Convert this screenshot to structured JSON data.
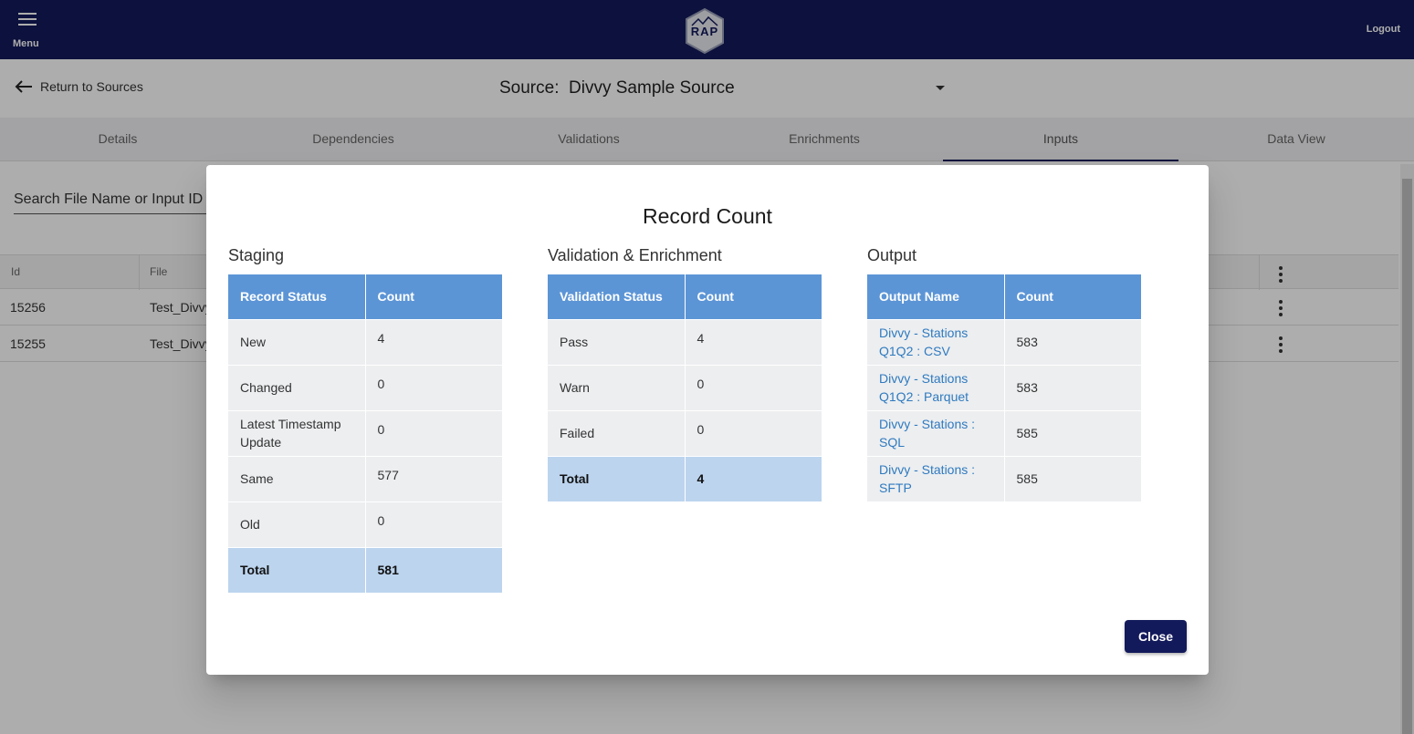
{
  "header": {
    "menu_label": "Menu",
    "logo_text": "RAP",
    "logout_label": "Logout"
  },
  "subheader": {
    "back_label": "Return to Sources",
    "source_title": "Source:  Divvy Sample Source"
  },
  "tabs": [
    {
      "label": "Details"
    },
    {
      "label": "Dependencies"
    },
    {
      "label": "Validations"
    },
    {
      "label": "Enrichments"
    },
    {
      "label": "Inputs",
      "active": true
    },
    {
      "label": "Data View"
    }
  ],
  "search": {
    "placeholder": "Search File Name or Input ID"
  },
  "grid": {
    "columns": [
      "Id",
      "File"
    ],
    "rows": [
      {
        "id": "15256",
        "file": "Test_Divvy"
      },
      {
        "id": "15255",
        "file": "Test_Divvy"
      }
    ]
  },
  "modal": {
    "title": "Record Count",
    "close_label": "Close",
    "staging": {
      "title": "Staging",
      "headers": [
        "Record Status",
        "Count"
      ],
      "rows": [
        {
          "label": "New",
          "count": "4"
        },
        {
          "label": "Changed",
          "count": "0"
        },
        {
          "label": "Latest Timestamp Update",
          "count": "0"
        },
        {
          "label": "Same",
          "count": "577"
        },
        {
          "label": "Old",
          "count": "0"
        }
      ],
      "total": {
        "label": "Total",
        "count": "581"
      }
    },
    "validation": {
      "title": "Validation & Enrichment",
      "headers": [
        "Validation Status",
        "Count"
      ],
      "rows": [
        {
          "label": "Pass",
          "count": "4"
        },
        {
          "label": "Warn",
          "count": "0"
        },
        {
          "label": "Failed",
          "count": "0"
        }
      ],
      "total": {
        "label": "Total",
        "count": "4"
      }
    },
    "output": {
      "title": "Output",
      "headers": [
        "Output Name",
        "Count"
      ],
      "rows": [
        {
          "label": "Divvy - Stations Q1Q2 : CSV",
          "count": "583"
        },
        {
          "label": "Divvy - Stations Q1Q2 : Parquet",
          "count": "583"
        },
        {
          "label": "Divvy - Stations : SQL",
          "count": "585"
        },
        {
          "label": "Divvy - Stations : SFTP",
          "count": "585"
        }
      ]
    }
  },
  "colors": {
    "nav_bg": "#131a5b",
    "table_header": "#5c95d6",
    "total_row": "#bcd4ee",
    "link": "#2f7abf"
  }
}
